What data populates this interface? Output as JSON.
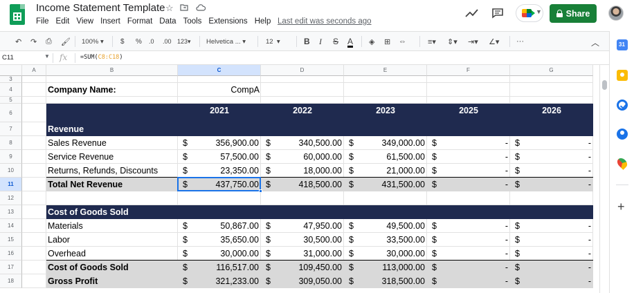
{
  "app": {
    "title": "Income Statement Template",
    "menu": [
      "File",
      "Edit",
      "View",
      "Insert",
      "Format",
      "Data",
      "Tools",
      "Extensions",
      "Help"
    ],
    "last_edit": "Last edit was seconds ago",
    "share_label": "Share"
  },
  "toolbar": {
    "zoom": "100%",
    "currency": "$",
    "percent": "%",
    "dec_decrease": ".0",
    "dec_increase": ".00",
    "more_formats": "123",
    "font": "Helvetica ...",
    "font_size": "12",
    "bold": "B",
    "italic": "I",
    "strike": "S",
    "text_color": "A",
    "more": "···"
  },
  "formula_bar": {
    "cell_ref": "C11",
    "fx": "fx",
    "formula_prefix": "=SUM(",
    "formula_range": "C8:C18",
    "formula_suffix": ")"
  },
  "columns": [
    "A",
    "B",
    "C",
    "D",
    "E",
    "F",
    "G"
  ],
  "rows": [
    "3",
    "4",
    "5",
    "6",
    "7",
    "8",
    "9",
    "10",
    "11",
    "12",
    "13",
    "14",
    "15",
    "16",
    "17",
    "18"
  ],
  "sheet": {
    "company_label": "Company Name:",
    "company_value": "CompA",
    "years": [
      "2021",
      "2022",
      "2023",
      "2025",
      "2026"
    ],
    "revenue_header": "Revenue",
    "revenue_rows": [
      {
        "label": "Sales Revenue",
        "values": [
          "356,900.00",
          "340,500.00",
          "349,000.00",
          "-",
          "-"
        ]
      },
      {
        "label": "Service Revenue",
        "values": [
          "57,500.00",
          "60,000.00",
          "61,500.00",
          "-",
          "-"
        ]
      },
      {
        "label": "Returns, Refunds, Discounts",
        "values": [
          "23,350.00",
          "18,000.00",
          "21,000.00",
          "-",
          "-"
        ]
      }
    ],
    "total_revenue": {
      "label": "Total Net Revenue",
      "values": [
        "437,750.00",
        "418,500.00",
        "431,500.00",
        "-",
        "-"
      ]
    },
    "cogs_header": "Cost of Goods Sold",
    "cogs_rows": [
      {
        "label": "Materials",
        "values": [
          "50,867.00",
          "47,950.00",
          "49,500.00",
          "-",
          "-"
        ]
      },
      {
        "label": "Labor",
        "values": [
          "35,650.00",
          "30,500.00",
          "33,500.00",
          "-",
          "-"
        ]
      },
      {
        "label": "Overhead",
        "values": [
          "30,000.00",
          "31,000.00",
          "30,000.00",
          "-",
          "-"
        ]
      }
    ],
    "total_cogs": {
      "label": "Cost of Goods Sold",
      "values": [
        "116,517.00",
        "109,450.00",
        "113,000.00",
        "-",
        "-"
      ]
    },
    "gross_profit": {
      "label": "Gross Profit",
      "values": [
        "321,233.00",
        "309,050.00",
        "318,500.00",
        "-",
        "-"
      ]
    },
    "currency_symbol": "$"
  },
  "icons": {
    "star": "star-icon",
    "move": "folder-move-icon",
    "cloud": "cloud-status-icon",
    "trend": "activity-trend-icon",
    "comment": "comment-icon",
    "meet": "meet-icon"
  },
  "colors": {
    "header_band": "#1f2a4f",
    "total_band": "#d9d9d9",
    "share": "#188038",
    "selection": "#1a73e8"
  }
}
